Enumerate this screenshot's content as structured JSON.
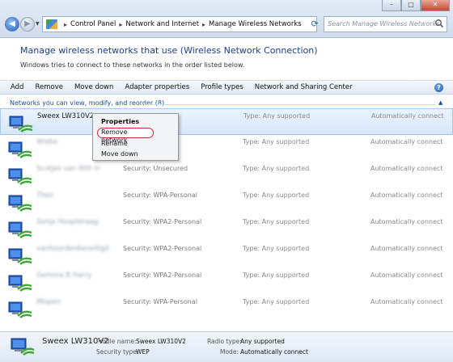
{
  "address_bar": {
    "breadcrumb": [
      "Control Panel",
      "Network and Internet",
      "Manage Wireless Networks"
    ],
    "search_placeholder": "Search Manage Wireless Networks"
  },
  "header": {
    "title": "Manage wireless networks that use (Wireless Network Connection)",
    "subtitle": "Windows tries to connect to these networks in the order listed below."
  },
  "toolbar": {
    "add": "Add",
    "remove": "Remove",
    "move_down": "Move down",
    "adapter_properties": "Adapter properties",
    "profile_types": "Profile types",
    "network_sharing_center": "Network and Sharing Center"
  },
  "group": {
    "label": "Networks you can view, modify, and reorder (8)"
  },
  "networks": [
    {
      "name": "Sweex LW310V2",
      "security": "",
      "type": "Type: Any supported",
      "mode": "Automatically connect",
      "selected": true
    },
    {
      "name": "Wiebe",
      "security": "",
      "type": "Type: Any supported",
      "mode": "Automatically connect"
    },
    {
      "name": "Scotjes van 000 nl",
      "security": "Security: Unsecured",
      "type": "Type: Any supported",
      "mode": "Automatically connect"
    },
    {
      "name": "Theo",
      "security": "Security: WPA-Personal",
      "type": "Type: Any supported",
      "mode": "Automatically connect"
    },
    {
      "name": "Sonja Hoopteraag",
      "security": "Security: WPA2-Personal",
      "type": "Type: Any supported",
      "mode": "Automatically connect"
    },
    {
      "name": "vanhoordenbeveiligd",
      "security": "Security: WPA2-Personal",
      "type": "Type: Any supported",
      "mode": "Automatically connect"
    },
    {
      "name": "Gemma B Harry",
      "security": "Security: WPA2-Personal",
      "type": "Type: Any supported",
      "mode": "Automatically connect"
    },
    {
      "name": "Mispen",
      "security": "Security: WPA-Personal",
      "type": "Type: Any supported",
      "mode": "Automatically connect"
    }
  ],
  "context_menu": {
    "items": [
      "Properties",
      "Remove network",
      "Rename",
      "Move down"
    ]
  },
  "details": {
    "name": "Sweex LW310V2",
    "profile_name_label": "Profile name:",
    "profile_name": "Sweex LW310V2",
    "security_type_label": "Security type:",
    "security_type": "WEP",
    "radio_type_label": "Radio type:",
    "radio_type": "Any supported",
    "mode_label": "Mode:",
    "mode": "Automatically connect"
  },
  "colors": {
    "title_blue": "#1e3f8e",
    "highlight_red": "#d0283a",
    "selection_bg": "#d6e8fb"
  }
}
